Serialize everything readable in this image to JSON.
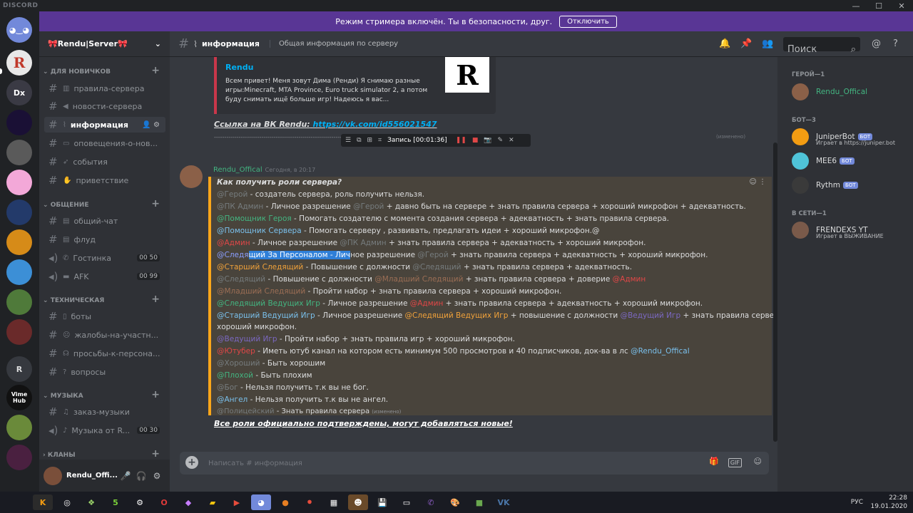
{
  "window": {
    "brand": "DISCORD",
    "controls": [
      "—",
      "☐",
      "✕"
    ]
  },
  "banner": {
    "text": "Режим стримера включён. Ты в безопасности, друг.",
    "button": "Отключить"
  },
  "rail": {
    "servers": [
      "R",
      "Dx",
      "",
      "",
      "",
      "",
      "",
      "",
      "",
      "",
      "",
      "",
      "R",
      "Vime Hub",
      "",
      ""
    ]
  },
  "server": {
    "name": "🎀Rendu|Server🎀"
  },
  "categories": {
    "newbies": "ДЛЯ НОВИЧКОВ",
    "general": "ОБЩЕНИЕ",
    "tech": "ТЕХНИЧЕСКАЯ",
    "music": "МУЗЫКА",
    "clans": "КЛАНЫ"
  },
  "channels": {
    "c1": "правила-сервера",
    "c2": "новости-сервера",
    "c3": "информация",
    "c4": "оповещения-о-нов...",
    "c5": "события",
    "c6": "приветствие",
    "c7": "общий-чат",
    "c8": "флуд",
    "c9": "Гостинка",
    "c9_count": "00 50",
    "c10": "AFK",
    "c10_count": "00 99",
    "c11": "боты",
    "c12": "жалобы-на-участн...",
    "c13": "просьбы-к-персона...",
    "c14": "вопросы",
    "c15": "заказ-музыки",
    "c16": "Музыка от R...",
    "c16_count": "00 30"
  },
  "user": {
    "name": "Rendu_Offi..."
  },
  "header": {
    "channel": "информация",
    "topic": "Общая информация по серверу",
    "search": "Поиск"
  },
  "embed": {
    "author": "Rendu",
    "description": "Всем привет! Меня зовут Дима (Ренди) Я снимаю разные игры:Minecraft, MTA Province, Euro truck simulator 2, а потом буду снимать ищё больше игр! Надеюсь я вас...",
    "thumb": "R"
  },
  "vk": {
    "label": "Ссылка на ВК Rendu:",
    "url": "https://vk.com/id556021547"
  },
  "separator": "------------------------------------------------------------------------------------------------------------------------------------------------------",
  "separator_edited": "(изменено)",
  "recorder": {
    "label": "Запись [00:01:36]"
  },
  "message": {
    "author": "Rendu_Offical",
    "time": "Сегодня, в 20:17",
    "title": "Как получить роли сервера?",
    "r1a": "@Герой",
    "r1b": " - создатель сервера, роль получить нельзя.",
    "r2a": "@ПК Админ",
    "r2b": " - Личное разрешение ",
    "r2c": "@Герой",
    "r2d": " + давно быть на  сервере + знать правила сервера + хороший микрофон + адекватность.",
    "r3a": "@Помощник Героя",
    "r3b": " - Помогать создателю  с момента создания сервера + адекватность + знать правила сервера.",
    "r4a": "@Помощник Сервера",
    "r4b": " - Помогать серверу , развивать, предлагать идеи + хороший микрофон.@",
    "r5a": "@Админ",
    "r5b": " - Личное разрешение ",
    "r5c": "@ПК Админ",
    "r5d": " + знать правила сервера + адекватность + хороший микрофон.",
    "r6a": "@Следя",
    "r6b": "щий За Персоналом - Лич",
    "r6c": "ное разрешение ",
    "r6d": "@Герой",
    "r6e": " + знать правила сервера + адекватность + хороший микрофон.",
    "r7a": "@Старший Следящий",
    "r7b": " - Повышение с должности ",
    "r7c": "@Следящий",
    "r7d": "  + знать правила сервера + адекватность.",
    "r8a": "@Следящий",
    "r8b": " - Повышение с должности ",
    "r8c": "@Младший Следящий",
    "r8d": " + знать правила сервера + доверие ",
    "r8e": "@Админ",
    "r9a": "@Младший Следящий",
    "r9b": " - Пройти набор + знать правила сервера + хороший микрофон.",
    "r10a": "@Следящий Ведущих Игр",
    "r10b": " - Личное разрешение ",
    "r10c": "@Админ",
    "r10d": " + знать правила сервера + адекватность + хороший микрофон.",
    "r11a": "@Старший Ведущий Игр",
    "r11b": " - Личное разрешение ",
    "r11c": "@Следящий Ведущих Игр",
    "r11d": " + повышение с должности ",
    "r11e": "@Ведущий Игр",
    "r11f": " + знать правила сервера +",
    "r11g": "хороший микрофон.",
    "r12a": "@Ведущий Игр",
    "r12b": " - Пройти набор + знать правила игр + хороший микрофон.",
    "r13a": "@Ютубер",
    "r13b": " - Иметь ютуб канал на котором есть минимум 500 просмотров и 40 подписчиков, док-ва в лс ",
    "r13c": "@Rendu_Offical",
    "r14a": "@Хороший",
    "r14b": " - Быть хорошим",
    "r15a": "@Плохой",
    "r15b": " - Быть плохим",
    "r16a": "@Бог",
    "r16b": " - Нельзя получить т.к вы не бог.",
    "r17a": "@Ангел",
    "r17b": " - Нельзя получить т.к вы не ангел.",
    "r18a": "@Полицейский",
    "r18b": " - Знать правила сервера ",
    "r18c": "(изменено)",
    "final": "Все роли официально подтверждены, могут добавляться новые!"
  },
  "input": {
    "placeholder": "Написать #   информация"
  },
  "members": {
    "cat1": "ГЕРОЙ—1",
    "cat2": "БОТ—3",
    "cat3": "В СЕТИ—1",
    "m1": "Rendu_Offical",
    "m2": "JuniperBot",
    "m2_status": "Играет в https://juniper.bot",
    "m3": "MEE6",
    "m4": "Rythm",
    "m5": "FRENDEXS YT",
    "m5_status": "Играет в ВЫЖИВАНИЕ",
    "bot_badge": "БОТ"
  },
  "taskbar": {
    "time": "22:28",
    "date": "19.01.2020",
    "lang": "РУС"
  },
  "colors": {
    "accent": "#593695",
    "brand": "#7289da",
    "online": "#43b581",
    "mention_highlight": "#faa61a"
  }
}
